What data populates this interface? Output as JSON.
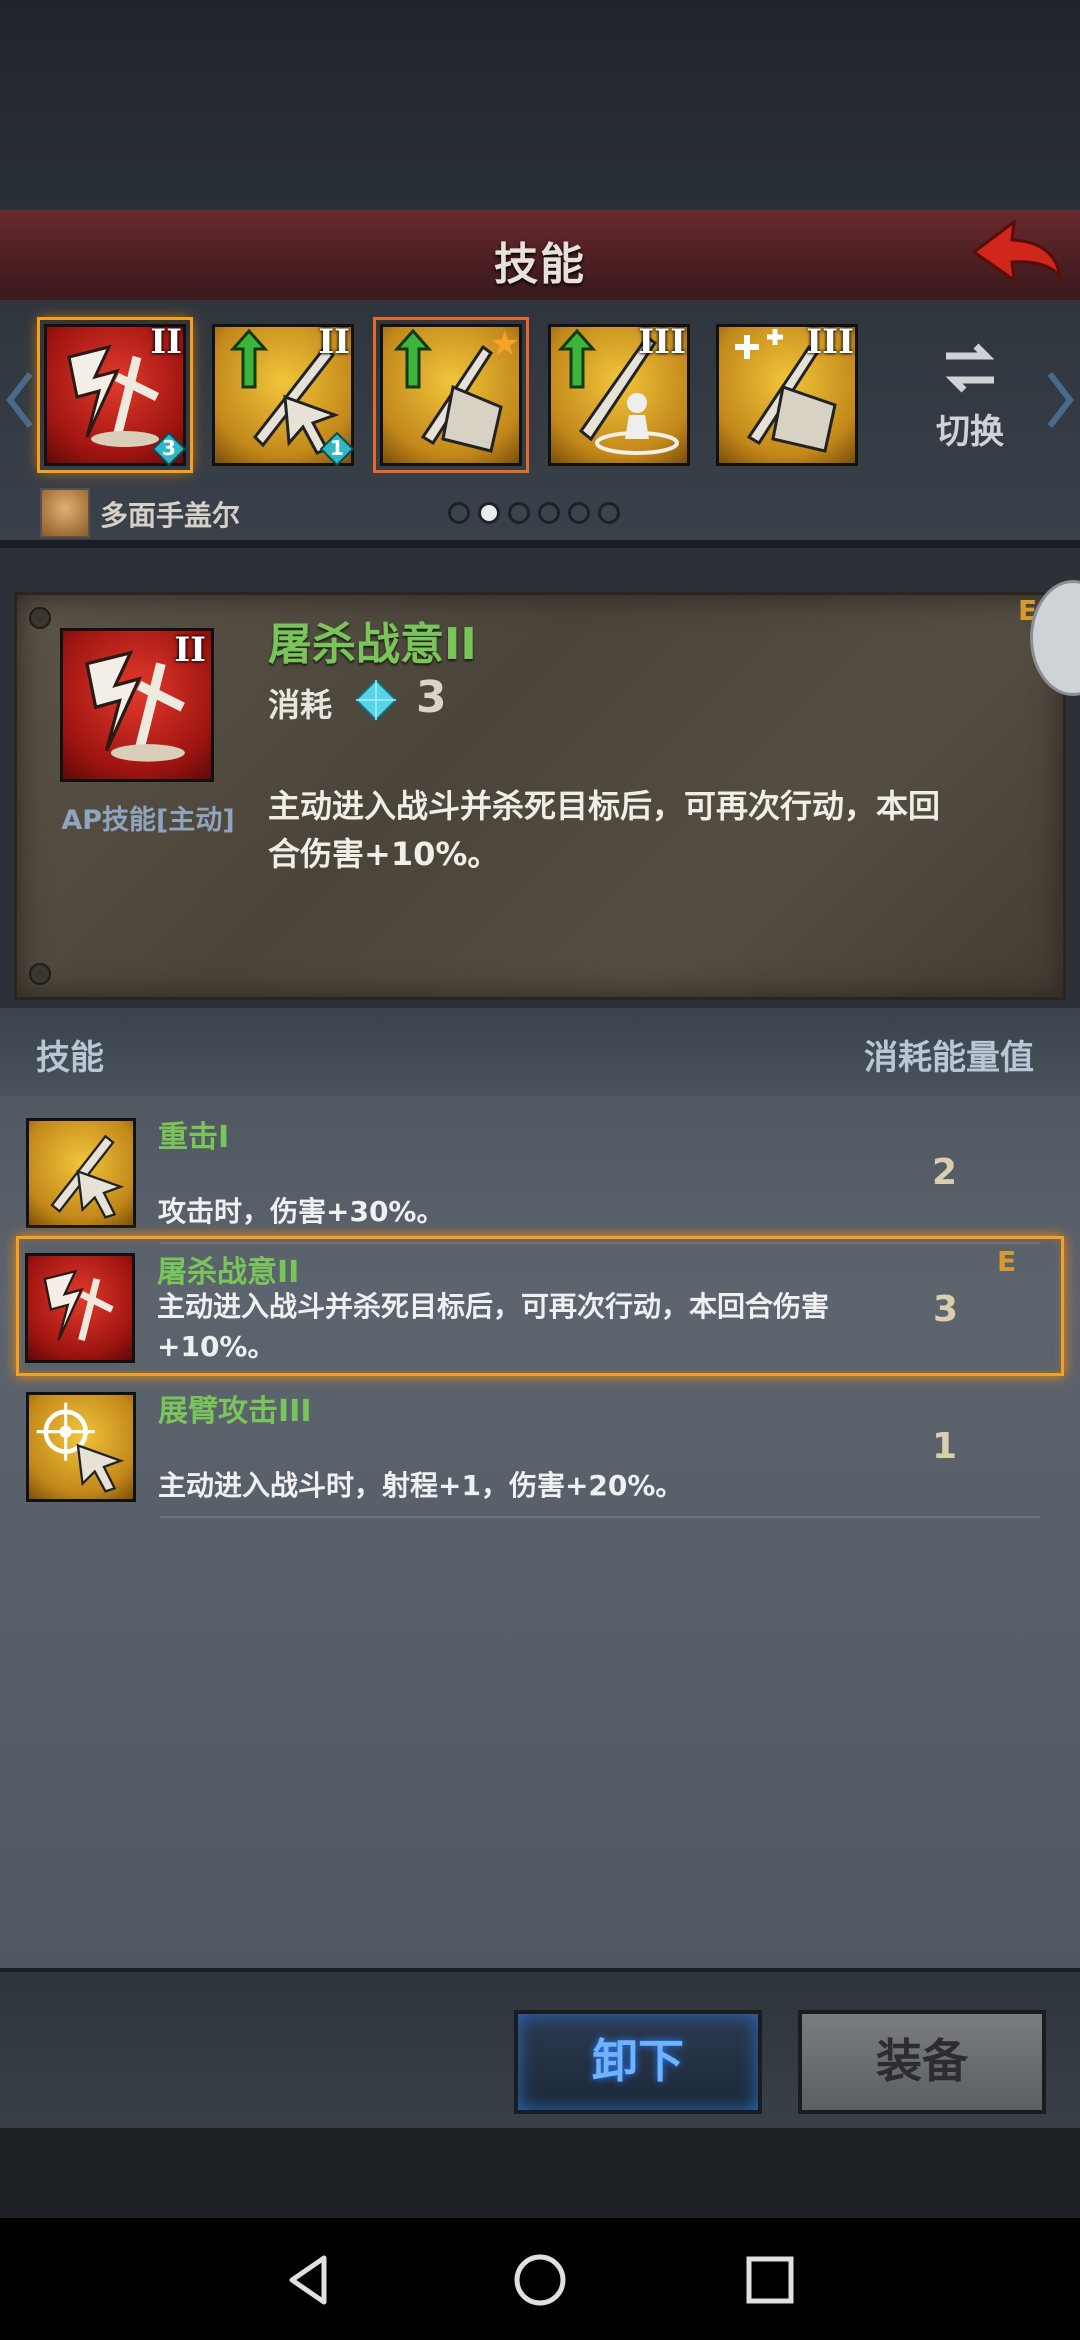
{
  "header": {
    "title": "技能"
  },
  "strip": {
    "slots": [
      {
        "roman": "II",
        "badge": "3",
        "bg": "red"
      },
      {
        "roman": "II",
        "badge": "1",
        "bg": "gold"
      },
      {
        "roman": "",
        "badge": "",
        "bg": "gold",
        "star": true
      },
      {
        "roman": "III",
        "badge": "",
        "bg": "gold"
      },
      {
        "roman": "III",
        "badge": "",
        "bg": "gold"
      }
    ],
    "switch_label": "切换",
    "character_name": "多面手盖尔",
    "page_count": 6,
    "page_active": 1
  },
  "detail": {
    "roman": "II",
    "name": "屠杀战意II",
    "cost_label": "消耗",
    "cost_value": "3",
    "type_label": "AP技能[主动]",
    "description": "主动进入战斗并杀死目标后，可再次行动，本回合伤害+10%。",
    "equipped_mark": "E"
  },
  "list": {
    "header_left": "技能",
    "header_right": "消耗能量值",
    "rows": [
      {
        "name": "重击I",
        "description": "攻击时，伤害+30%。",
        "cost": "2",
        "mark": ""
      },
      {
        "name": "屠杀战意II",
        "description": "主动进入战斗并杀死目标后，可再次行动，本回合伤害+10%。",
        "cost": "3",
        "mark": "E"
      },
      {
        "name": "展臂攻击III",
        "description": "主动进入战斗时，射程+1，伤害+20%。",
        "cost": "1",
        "mark": ""
      }
    ]
  },
  "buttons": {
    "unequip": "卸下",
    "equip": "装备"
  },
  "colors": {
    "accent_orange": "#f5a020",
    "skill_name_green": "#7ac55a",
    "unequip_blue": "#6fb3ff"
  }
}
